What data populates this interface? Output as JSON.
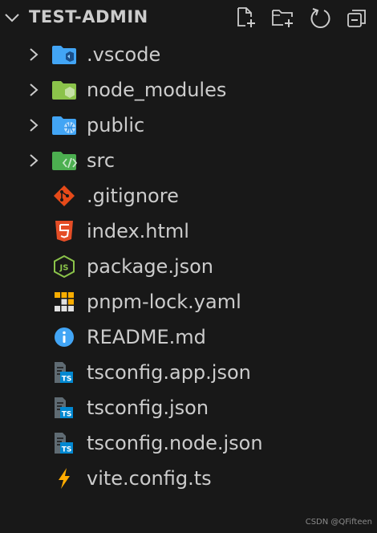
{
  "explorer": {
    "title": "TEST-ADMIN",
    "actions": [
      {
        "name": "new-file",
        "icon": "new-file-icon"
      },
      {
        "name": "new-folder",
        "icon": "new-folder-icon"
      },
      {
        "name": "refresh",
        "icon": "refresh-icon"
      },
      {
        "name": "collapse-all",
        "icon": "collapse-all-icon"
      }
    ]
  },
  "tree": {
    "items": [
      {
        "label": ".vscode",
        "type": "folder",
        "icon": "vscode-folder-icon",
        "collapsed": true
      },
      {
        "label": "node_modules",
        "type": "folder",
        "icon": "node-folder-icon",
        "collapsed": true
      },
      {
        "label": "public",
        "type": "folder",
        "icon": "public-folder-icon",
        "collapsed": true
      },
      {
        "label": "src",
        "type": "folder",
        "icon": "src-folder-icon",
        "collapsed": true
      },
      {
        "label": ".gitignore",
        "type": "file",
        "icon": "git-icon"
      },
      {
        "label": "index.html",
        "type": "file",
        "icon": "html5-icon"
      },
      {
        "label": "package.json",
        "type": "file",
        "icon": "nodejs-icon"
      },
      {
        "label": "pnpm-lock.yaml",
        "type": "file",
        "icon": "pnpm-icon"
      },
      {
        "label": "README.md",
        "type": "file",
        "icon": "info-icon"
      },
      {
        "label": "tsconfig.app.json",
        "type": "file",
        "icon": "tsconfig-icon"
      },
      {
        "label": "tsconfig.json",
        "type": "file",
        "icon": "tsconfig-icon"
      },
      {
        "label": "tsconfig.node.json",
        "type": "file",
        "icon": "tsconfig-icon"
      },
      {
        "label": "vite.config.ts",
        "type": "file",
        "icon": "vite-icon"
      }
    ]
  },
  "watermark": "CSDN @QFifteen",
  "colors": {
    "background": "#181818",
    "text": "#cccccc",
    "folder_blue": "#42a5f5",
    "folder_green": "#8bc34a",
    "git": "#e64a19",
    "html": "#e44d26",
    "ts": "#0288d1",
    "vite": "#ffab00"
  }
}
